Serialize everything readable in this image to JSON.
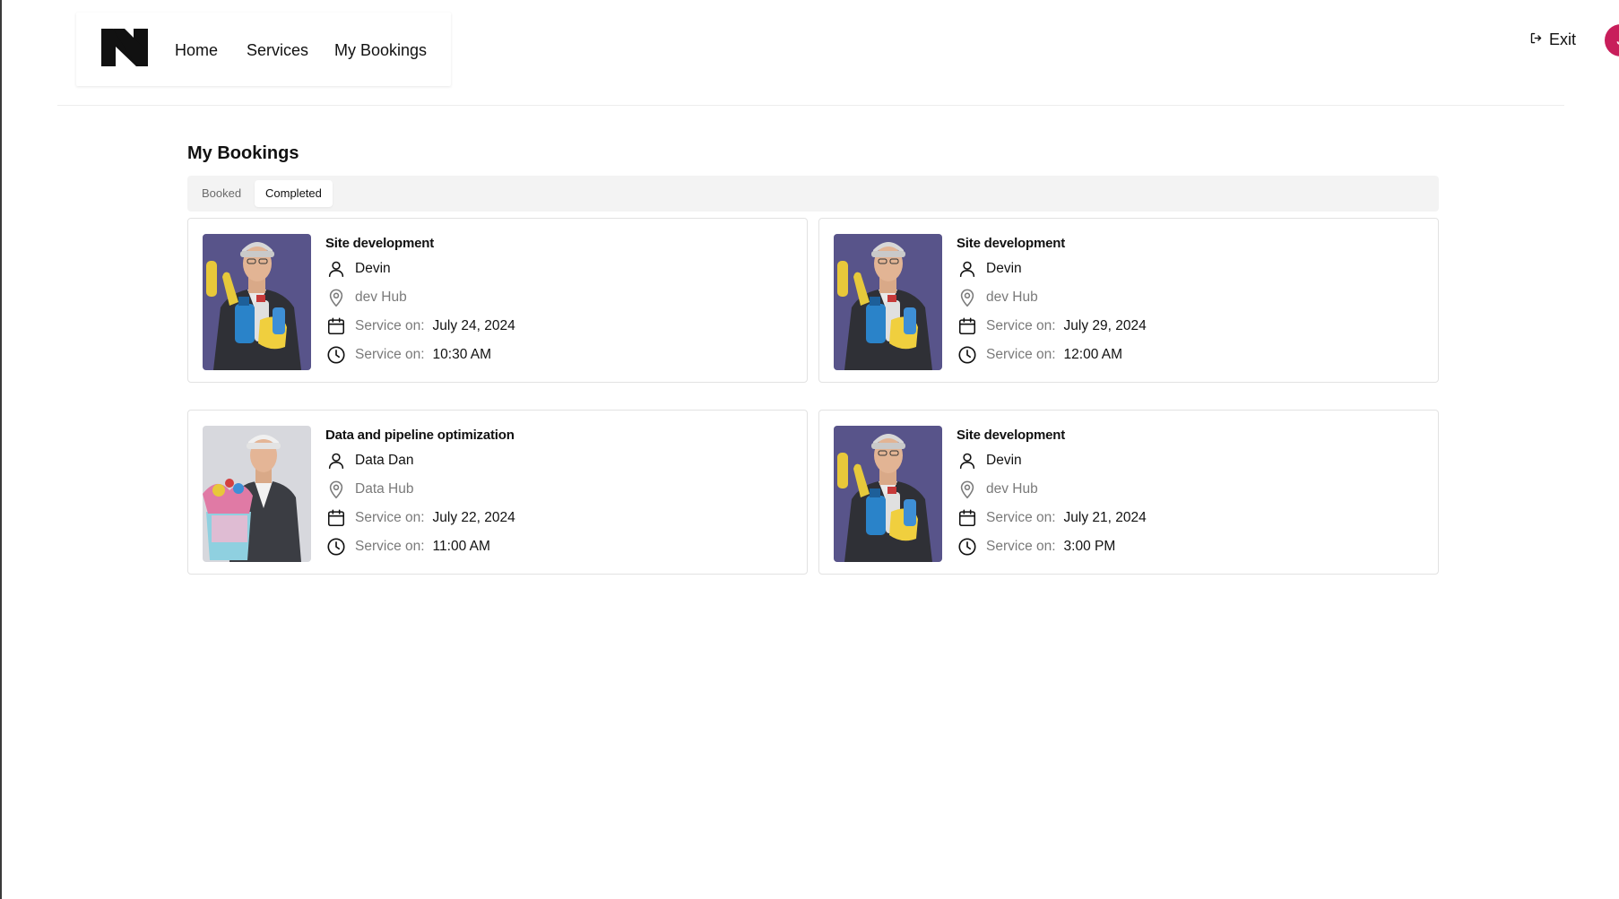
{
  "nav": {
    "logo_alt": "N",
    "links": [
      "Home",
      "Services",
      "My Bookings"
    ],
    "exit_label": "Exit",
    "avatar_initial": "J",
    "avatar_color": "#c81e5b"
  },
  "main": {
    "title": "My Bookings",
    "tabs": [
      {
        "label": "Booked",
        "active": false
      },
      {
        "label": "Completed",
        "active": true
      }
    ],
    "bookings": [
      {
        "title": "Site development",
        "provider": "Devin",
        "location": "dev Hub",
        "date_label": "Service on:",
        "date": "July 24, 2024",
        "time_label": "Service on:",
        "time": "10:30 AM",
        "image": "cleaner-with-spray"
      },
      {
        "title": "Site development",
        "provider": "Devin",
        "location": "dev Hub",
        "date_label": "Service on:",
        "date": "July 29, 2024",
        "time_label": "Service on:",
        "time": "12:00 AM",
        "image": "cleaner-with-spray"
      },
      {
        "title": "Data and pipeline optimization",
        "provider": "Data Dan",
        "location": "Data Hub",
        "date_label": "Service on:",
        "date": "July 22, 2024",
        "time_label": "Service on:",
        "time": "11:00 AM",
        "image": "cleaner-with-bucket"
      },
      {
        "title": "Site development",
        "provider": "Devin",
        "location": "dev Hub",
        "date_label": "Service on:",
        "date": "July 21, 2024",
        "time_label": "Service on:",
        "time": "3:00 PM",
        "image": "cleaner-with-spray"
      }
    ]
  }
}
